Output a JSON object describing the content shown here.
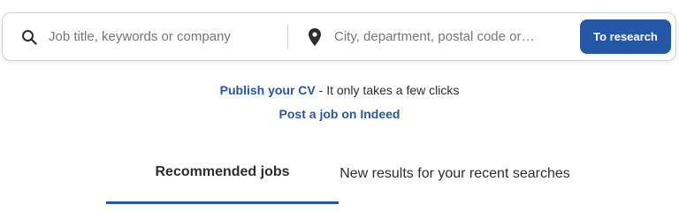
{
  "search": {
    "what_placeholder": "Job title, keywords or company",
    "where_placeholder": "City, department, postal code or…",
    "submit_label": "To research"
  },
  "cta": {
    "publish_cv_link": "Publish your CV",
    "publish_cv_suffix": " - It only takes a few clicks",
    "post_job_link": "Post a job on Indeed"
  },
  "tabs": [
    {
      "label": "Recommended jobs",
      "selected": true
    },
    {
      "label": "New results for your recent searches",
      "selected": false
    }
  ],
  "colors": {
    "brand_blue": "#2557a7",
    "text_dark": "#2d2d2d",
    "placeholder_gray": "#767676",
    "border_gray": "#d4d2d0"
  },
  "icons": {
    "what_field": "search-icon",
    "where_field": "location-pin-icon"
  }
}
